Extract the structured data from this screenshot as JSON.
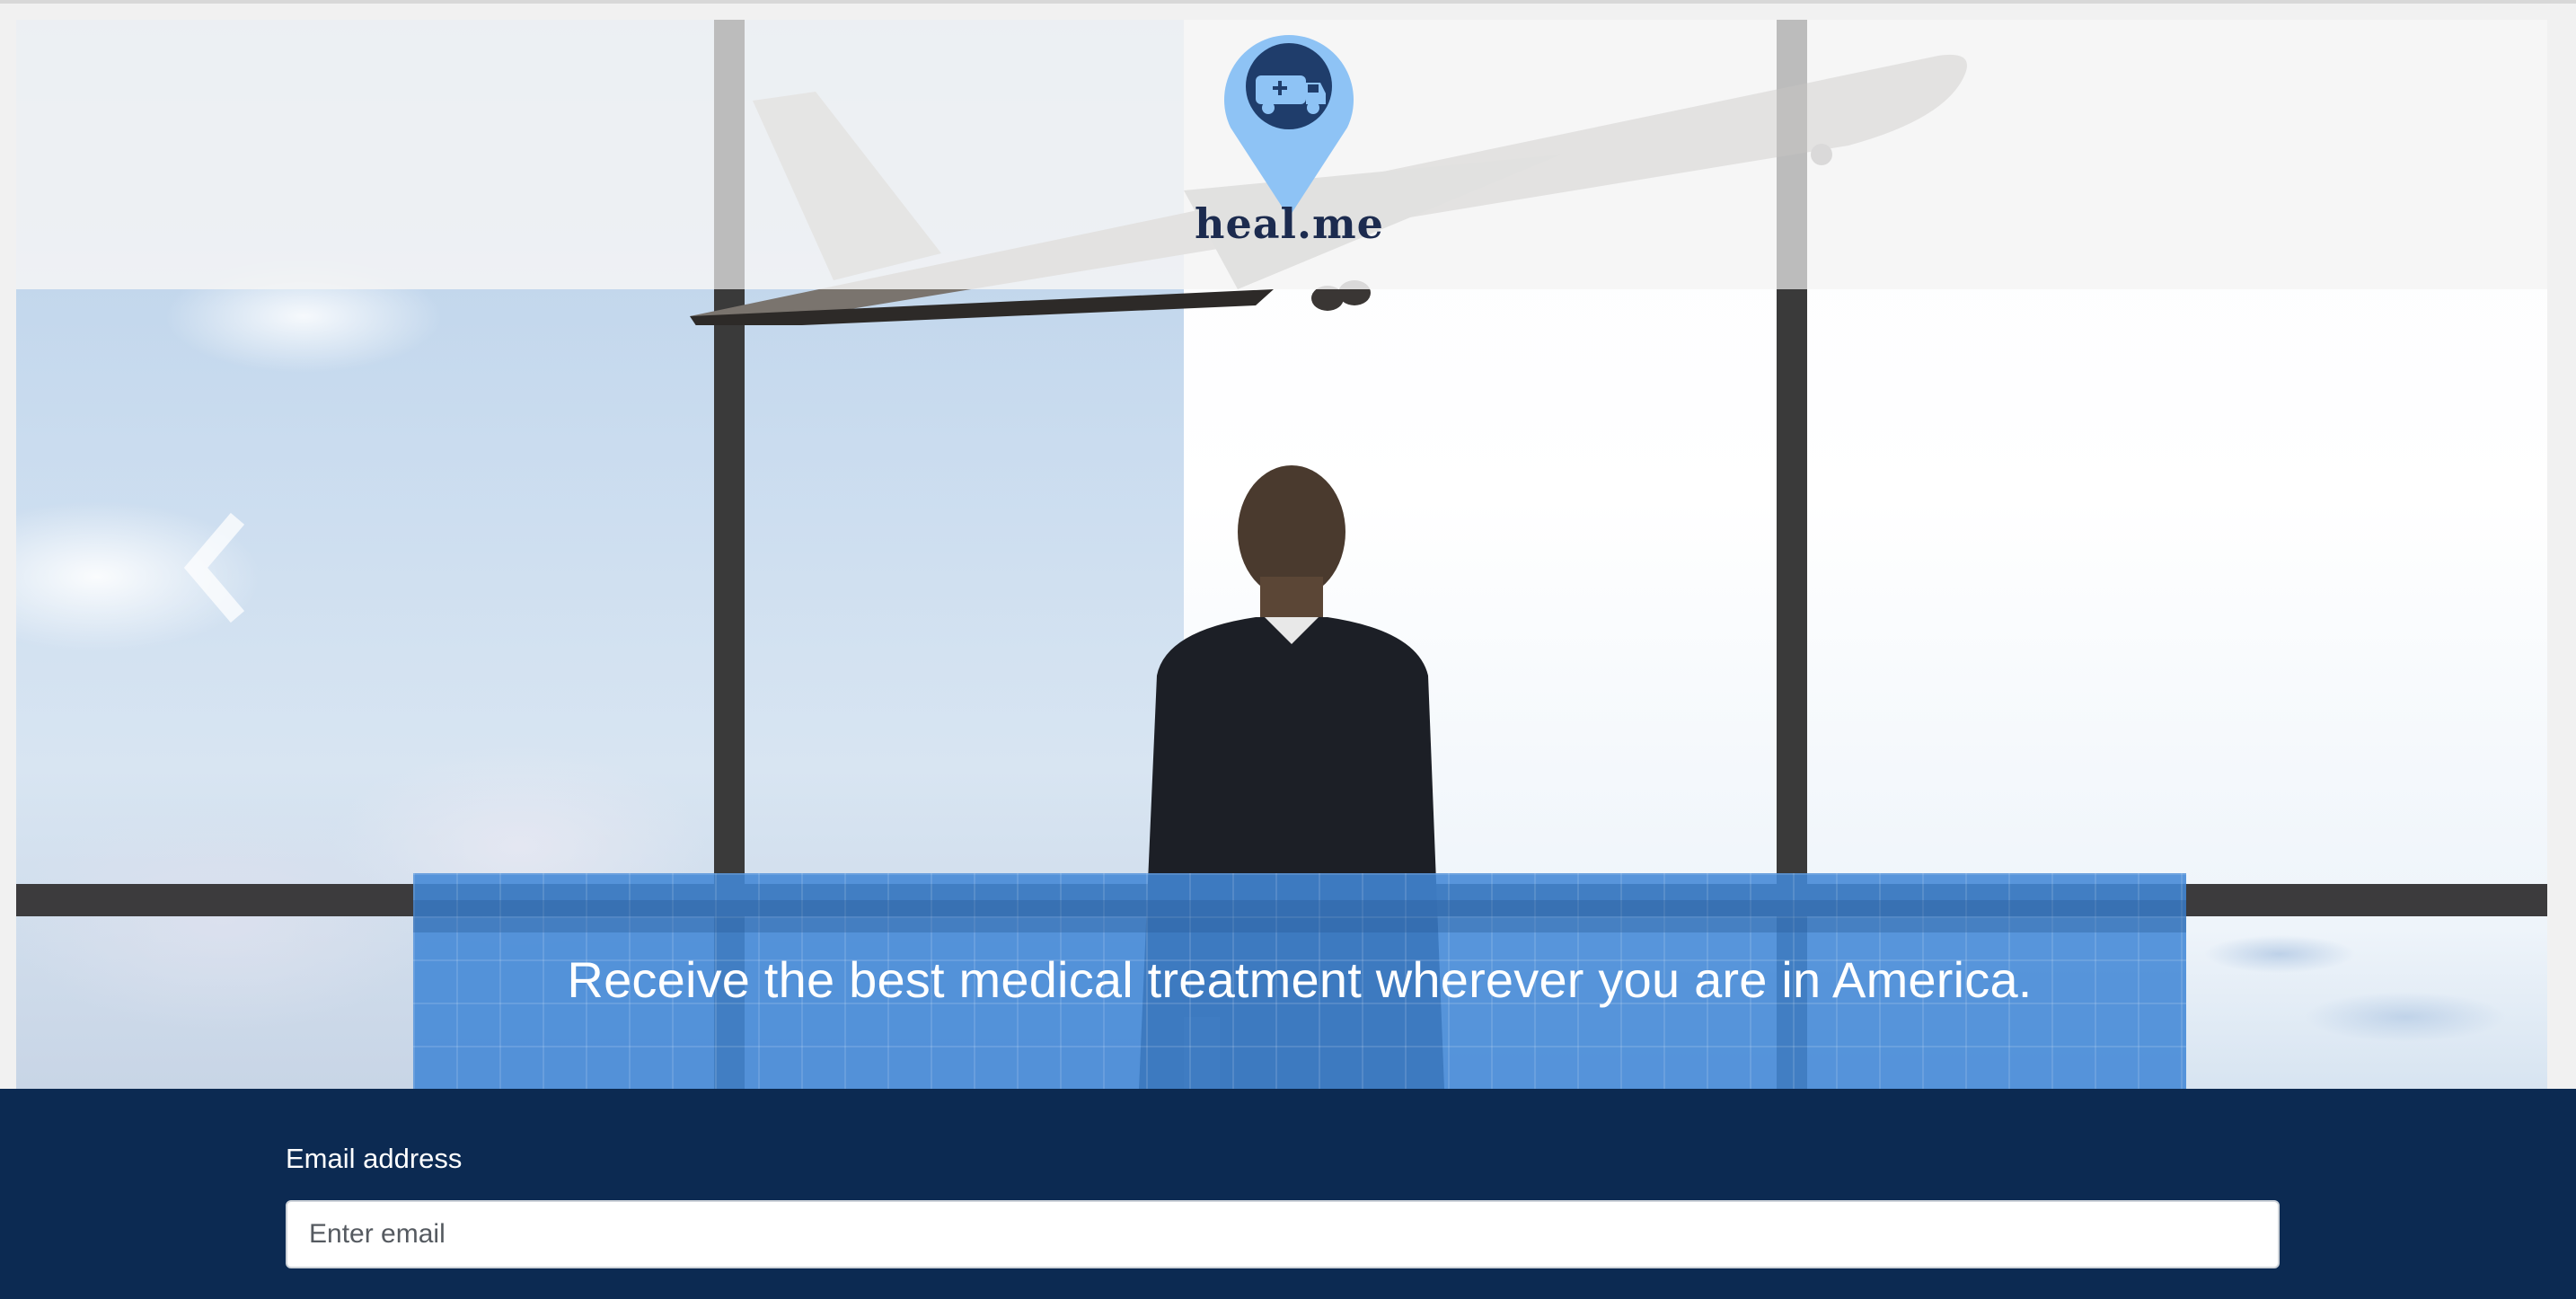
{
  "logo": {
    "text": "heal.me",
    "icon": "ambulance-pin-icon",
    "pin_color": "#8ec3f5",
    "badge_color": "#1f3d6b"
  },
  "hero": {
    "image": "man-watching-airplane-takeoff",
    "prev_control_icon": "chevron-left-icon",
    "banner_text": "Receive the best medical treatment wherever you are in America."
  },
  "signup": {
    "email_label": "Email address",
    "email_placeholder": "Enter email",
    "email_value": ""
  },
  "colors": {
    "banner_blue": "#4288d6",
    "footer_navy": "#0c2a52",
    "logo_text": "#1c2b4f"
  }
}
